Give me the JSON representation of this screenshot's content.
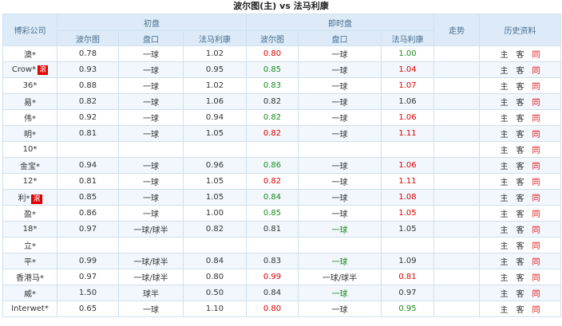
{
  "title": "波尔图(主) vs 法马利康",
  "headers": {
    "company": "博彩公司",
    "initial": "初盘",
    "live": "即时盘",
    "trend": "走势",
    "history": "历史资料",
    "home": "波尔图",
    "handicap": "盘口",
    "away": "法马利康"
  },
  "history_links": {
    "home": "主",
    "away": "客",
    "same": "同"
  },
  "colors": {
    "up": "#e00000",
    "down": "#1c8a1c",
    "header_bg": "#dcebf7"
  },
  "rows": [
    {
      "company": "澳*",
      "tag": "",
      "i_home": "0.78",
      "i_hcp": "一球",
      "i_away": "1.02",
      "l_home": "0.80",
      "l_home_c": "red",
      "l_hcp": "一球",
      "l_hcp_c": "",
      "l_away": "1.00",
      "l_away_c": "green"
    },
    {
      "company": "Crow*",
      "tag": "滚",
      "i_home": "0.93",
      "i_hcp": "一球",
      "i_away": "0.95",
      "l_home": "0.85",
      "l_home_c": "green",
      "l_hcp": "一球",
      "l_hcp_c": "",
      "l_away": "1.04",
      "l_away_c": "red"
    },
    {
      "company": "36*",
      "tag": "",
      "i_home": "0.88",
      "i_hcp": "一球",
      "i_away": "1.02",
      "l_home": "0.83",
      "l_home_c": "green",
      "l_hcp": "一球",
      "l_hcp_c": "",
      "l_away": "1.07",
      "l_away_c": "red"
    },
    {
      "company": "易*",
      "tag": "",
      "i_home": "0.82",
      "i_hcp": "一球",
      "i_away": "1.06",
      "l_home": "0.82",
      "l_home_c": "",
      "l_hcp": "一球",
      "l_hcp_c": "",
      "l_away": "1.06",
      "l_away_c": ""
    },
    {
      "company": "伟*",
      "tag": "",
      "i_home": "0.92",
      "i_hcp": "一球",
      "i_away": "0.94",
      "l_home": "0.82",
      "l_home_c": "green",
      "l_hcp": "一球",
      "l_hcp_c": "",
      "l_away": "1.06",
      "l_away_c": "red"
    },
    {
      "company": "明*",
      "tag": "",
      "i_home": "0.81",
      "i_hcp": "一球",
      "i_away": "1.05",
      "l_home": "0.82",
      "l_home_c": "red",
      "l_hcp": "一球",
      "l_hcp_c": "",
      "l_away": "1.11",
      "l_away_c": "red"
    },
    {
      "company": "10*",
      "tag": "",
      "i_home": "",
      "i_hcp": "",
      "i_away": "",
      "l_home": "",
      "l_home_c": "",
      "l_hcp": "",
      "l_hcp_c": "",
      "l_away": "",
      "l_away_c": ""
    },
    {
      "company": "金宝*",
      "tag": "",
      "i_home": "0.94",
      "i_hcp": "一球",
      "i_away": "0.96",
      "l_home": "0.86",
      "l_home_c": "green",
      "l_hcp": "一球",
      "l_hcp_c": "",
      "l_away": "1.06",
      "l_away_c": "red"
    },
    {
      "company": "12*",
      "tag": "",
      "i_home": "0.81",
      "i_hcp": "一球",
      "i_away": "1.05",
      "l_home": "0.82",
      "l_home_c": "red",
      "l_hcp": "一球",
      "l_hcp_c": "",
      "l_away": "1.11",
      "l_away_c": "red"
    },
    {
      "company": "利*",
      "tag": "滚",
      "i_home": "0.85",
      "i_hcp": "一球",
      "i_away": "1.05",
      "l_home": "0.84",
      "l_home_c": "green",
      "l_hcp": "一球",
      "l_hcp_c": "",
      "l_away": "1.08",
      "l_away_c": "red"
    },
    {
      "company": "盈*",
      "tag": "",
      "i_home": "0.86",
      "i_hcp": "一球",
      "i_away": "1.00",
      "l_home": "0.85",
      "l_home_c": "green",
      "l_hcp": "一球",
      "l_hcp_c": "",
      "l_away": "1.05",
      "l_away_c": "red"
    },
    {
      "company": "18*",
      "tag": "",
      "i_home": "0.97",
      "i_hcp": "一球/球半",
      "i_away": "0.82",
      "l_home": "0.81",
      "l_home_c": "",
      "l_hcp": "一球",
      "l_hcp_c": "green",
      "l_away": "1.05",
      "l_away_c": ""
    },
    {
      "company": "立*",
      "tag": "",
      "i_home": "",
      "i_hcp": "",
      "i_away": "",
      "l_home": "",
      "l_home_c": "",
      "l_hcp": "",
      "l_hcp_c": "",
      "l_away": "",
      "l_away_c": ""
    },
    {
      "company": "平*",
      "tag": "",
      "i_home": "0.99",
      "i_hcp": "一球/球半",
      "i_away": "0.84",
      "l_home": "0.83",
      "l_home_c": "",
      "l_hcp": "一球",
      "l_hcp_c": "green",
      "l_away": "1.09",
      "l_away_c": ""
    },
    {
      "company": "香港马*",
      "tag": "",
      "i_home": "0.97",
      "i_hcp": "一球/球半",
      "i_away": "0.80",
      "l_home": "0.99",
      "l_home_c": "red",
      "l_hcp": "一球/球半",
      "l_hcp_c": "",
      "l_away": "0.81",
      "l_away_c": "red"
    },
    {
      "company": "威*",
      "tag": "",
      "i_home": "1.50",
      "i_hcp": "球半",
      "i_away": "0.50",
      "l_home": "0.84",
      "l_home_c": "",
      "l_hcp": "一球",
      "l_hcp_c": "green",
      "l_away": "0.97",
      "l_away_c": ""
    },
    {
      "company": "Interwet*",
      "tag": "",
      "i_home": "0.65",
      "i_hcp": "一球",
      "i_away": "1.10",
      "l_home": "0.80",
      "l_home_c": "red",
      "l_hcp": "一球",
      "l_hcp_c": "",
      "l_away": "0.95",
      "l_away_c": "green"
    }
  ]
}
